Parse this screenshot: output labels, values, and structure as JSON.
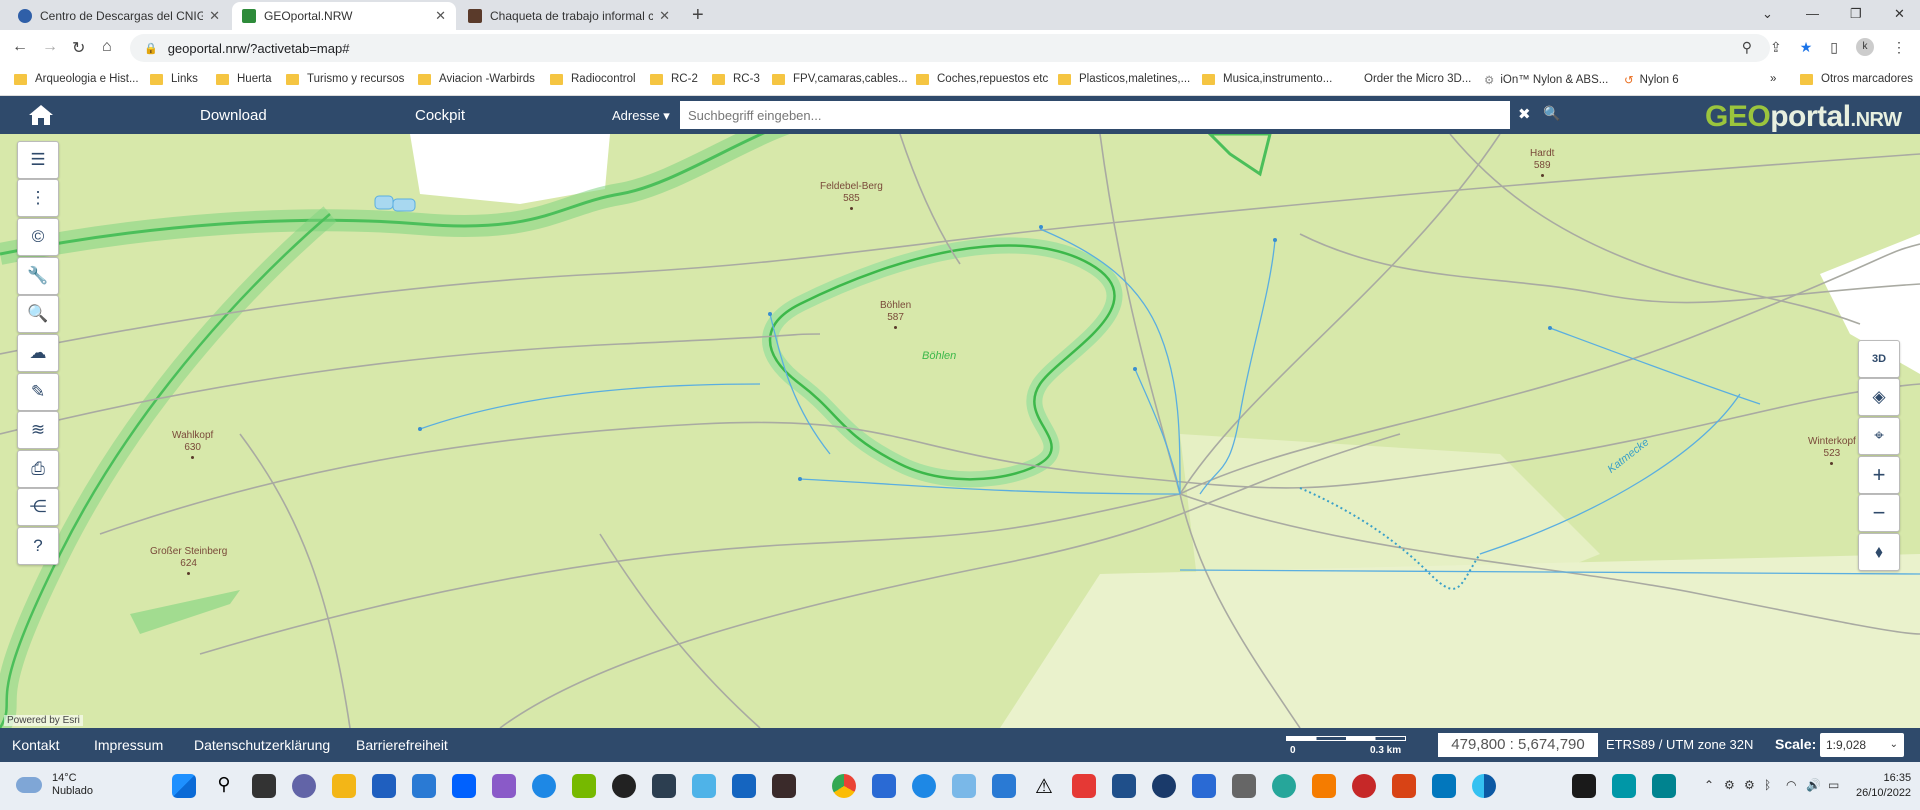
{
  "browser": {
    "tabs": [
      {
        "title": "Centro de Descargas del CNIG (I",
        "active": false,
        "icon": "cnig-favicon",
        "color": "#2f5fa8"
      },
      {
        "title": "GEOportal.NRW",
        "active": true,
        "icon": "geoportal-favicon",
        "color": "#2e8b3a"
      },
      {
        "title": "Chaqueta de trabajo informal cá",
        "active": false,
        "icon": "shop-favicon",
        "color": "#5a3a2a"
      }
    ],
    "url": "geoportal.nrw/?activetab=map#",
    "profile_initial": "k"
  },
  "bookmarks": [
    {
      "label": "Arqueologia e Hist..."
    },
    {
      "label": "Links"
    },
    {
      "label": "Huerta"
    },
    {
      "label": "Turismo y recursos"
    },
    {
      "label": "Aviacion -Warbirds"
    },
    {
      "label": "Radiocontrol"
    },
    {
      "label": "RC-2"
    },
    {
      "label": "RC-3"
    },
    {
      "label": "FPV,camaras,cables..."
    },
    {
      "label": "Coches,repuestos etc"
    },
    {
      "label": "Plasticos,maletines,..."
    },
    {
      "label": "Musica,instrumento..."
    },
    {
      "label": "Order the Micro 3D..."
    },
    {
      "label": "iOn™ Nylon & ABS..."
    },
    {
      "label": "Nylon 6"
    },
    {
      "label": "»"
    },
    {
      "label": "Otros marcadores"
    }
  ],
  "portal": {
    "nav": {
      "download": "Download",
      "cockpit": "Cockpit",
      "adresse": "Adresse ▾"
    },
    "search_placeholder": "Suchbegriff eingeben...",
    "logo": {
      "geo": "GEO",
      "portal": "portal",
      "nrw": ".NRW"
    }
  },
  "map": {
    "labels": [
      {
        "name": "Feldebel-Berg",
        "elev": "585"
      },
      {
        "name": "Hardt",
        "elev": "589"
      },
      {
        "name": "Böhlen",
        "elev": "587"
      },
      {
        "name": "Wahlkopf",
        "elev": "630"
      },
      {
        "name": "Großer Steinberg",
        "elev": "624"
      },
      {
        "name": "Winterkopf",
        "elev": "523"
      }
    ],
    "area_label": "Böhlen",
    "stream_label": "Katmecke",
    "powered_by": "Powered by Esri"
  },
  "left_tools": [
    {
      "name": "list-icon",
      "glyph": "☰"
    },
    {
      "name": "more-vertical-icon",
      "glyph": "⋮"
    },
    {
      "name": "copyright-icon",
      "glyph": "©"
    },
    {
      "name": "wrench-icon",
      "glyph": "🔧"
    },
    {
      "name": "info-search-icon",
      "glyph": "🔍"
    },
    {
      "name": "cloud-download-icon",
      "glyph": "☁"
    },
    {
      "name": "pencil-icon",
      "glyph": "✎"
    },
    {
      "name": "layers-settings-icon",
      "glyph": "≋"
    },
    {
      "name": "print-icon",
      "glyph": "⎙"
    },
    {
      "name": "share-icon",
      "glyph": "⋲"
    },
    {
      "name": "help-icon",
      "glyph": "?"
    }
  ],
  "right_tools": [
    {
      "name": "3d-view-icon",
      "glyph": "3D"
    },
    {
      "name": "layers-icon",
      "glyph": "◈"
    },
    {
      "name": "locate-icon",
      "glyph": "⌖"
    },
    {
      "name": "zoom-in-icon",
      "glyph": "+"
    },
    {
      "name": "zoom-out-icon",
      "glyph": "−"
    },
    {
      "name": "compass-icon",
      "glyph": "⬧"
    }
  ],
  "footer": {
    "links": [
      "Kontakt",
      "Impressum",
      "Datenschutzerklärung",
      "Barrierefreiheit"
    ],
    "scalebar": {
      "start": "0",
      "end": "0.3 km"
    },
    "coordinates": "479,800 : 5,674,790",
    "crs": "ETRS89 / UTM zone 32N",
    "scale_label": "Scale:",
    "scale_value": "1:9,028"
  },
  "taskbar": {
    "weather_temp": "14°C",
    "weather_desc": "Nublado",
    "time": "16:35",
    "date": "26/10/2022"
  }
}
